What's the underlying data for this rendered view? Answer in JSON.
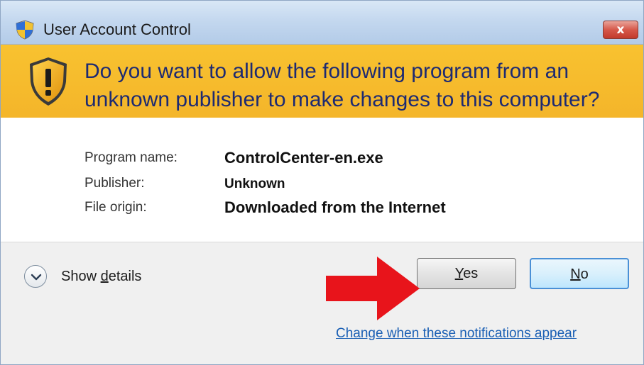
{
  "window": {
    "title": "User Account Control",
    "close_label": "x"
  },
  "banner": {
    "question": "Do you want to allow the following program from an unknown publisher to make changes to this computer?"
  },
  "program_info": {
    "rows": [
      {
        "label": "Program name:",
        "value": "ControlCenter-en.exe"
      },
      {
        "label": "Publisher:",
        "value": "Unknown"
      },
      {
        "label": "File origin:",
        "value": "Downloaded from the Internet"
      }
    ]
  },
  "footer": {
    "show_details_prefix": "Show ",
    "show_details_accel": "d",
    "show_details_suffix": "etails",
    "yes_accel": "Y",
    "yes_rest": "es",
    "no_accel": "N",
    "no_rest": "o",
    "change_link": "Change when these notifications appear"
  },
  "icons": {
    "title_icon": "uac-shield-icon",
    "warning_icon": "warning-shield-icon",
    "details_icon": "chevron-down-icon",
    "annotation": "red-arrow-icon"
  },
  "colors": {
    "banner": "#f6b92c",
    "question_text": "#1d2a72",
    "link": "#1a5fb4",
    "arrow": "#e8141b"
  }
}
